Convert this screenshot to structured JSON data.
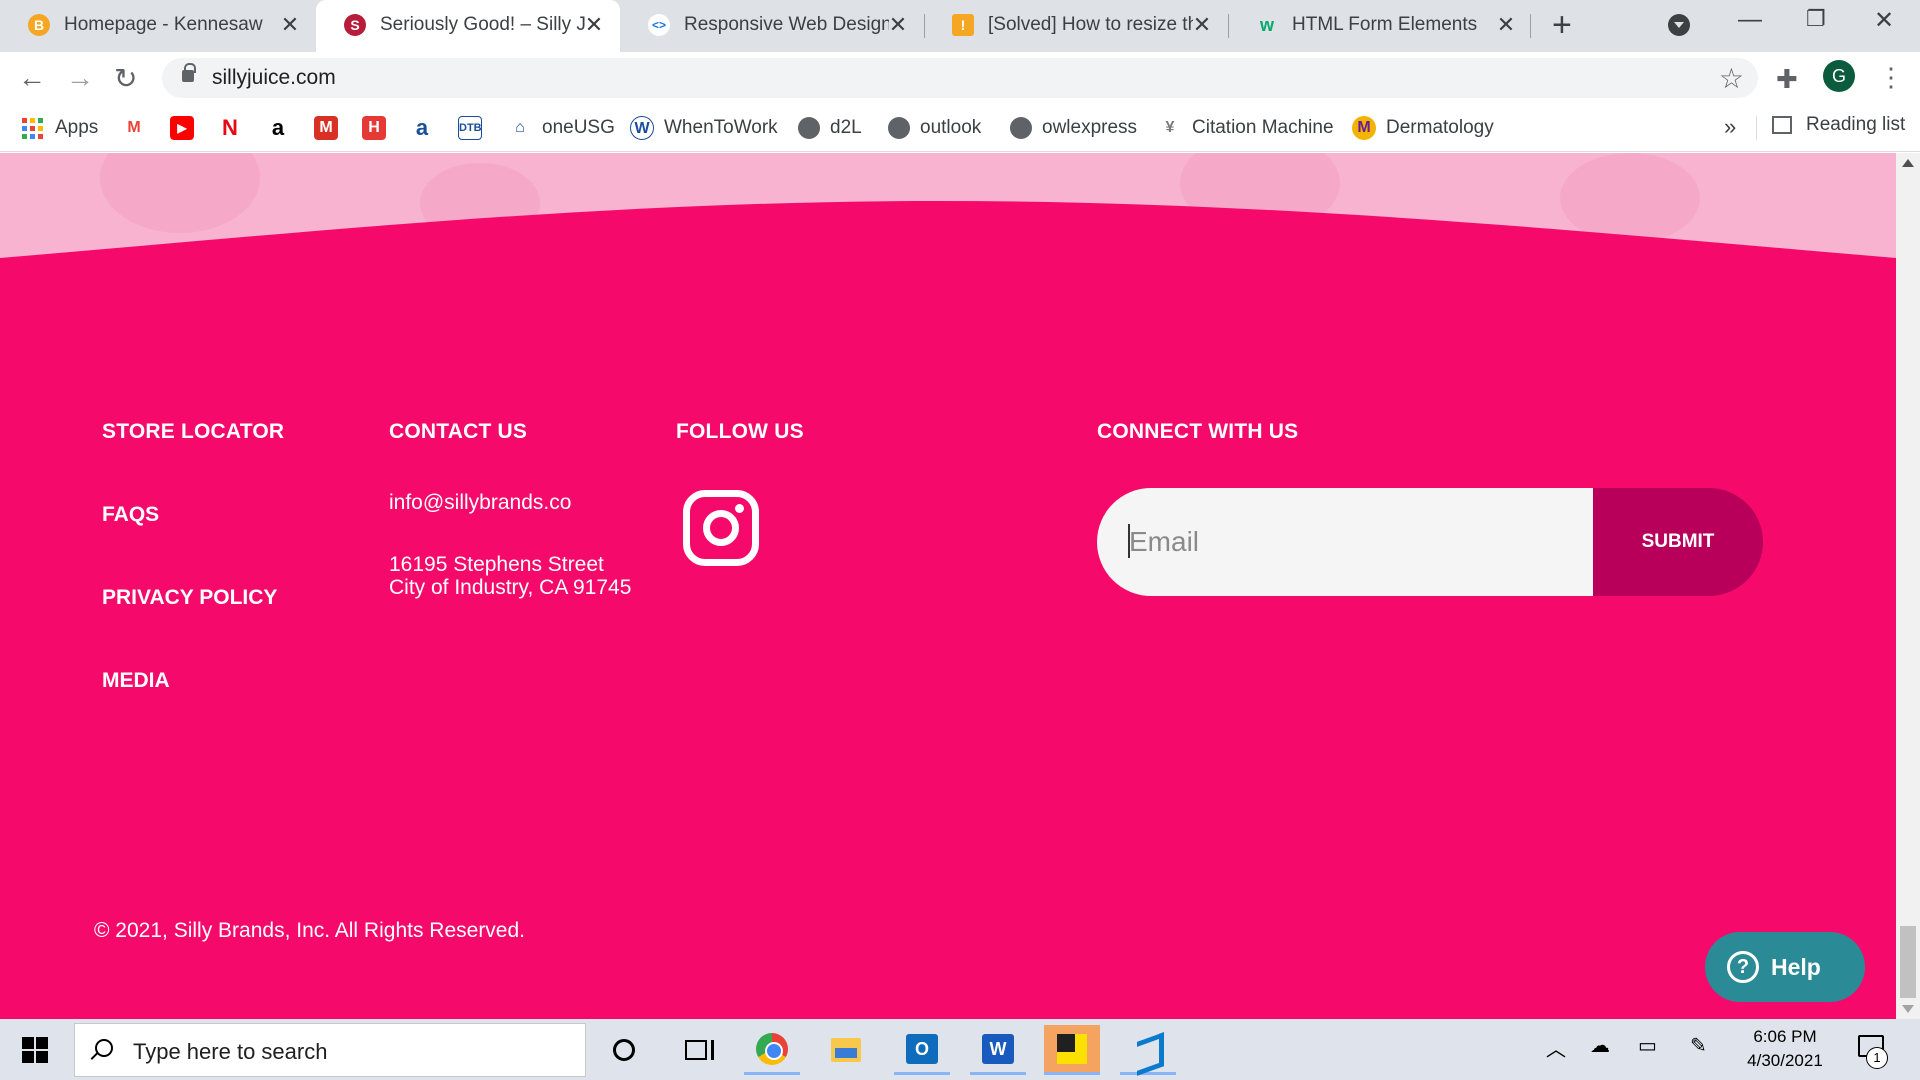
{
  "browser": {
    "tabs": [
      {
        "title": "Homepage - Kennesaw State",
        "favicon": "kennesaw-icon"
      },
      {
        "title": "Seriously Good! – Silly Juice",
        "favicon": "silly-juice-icon"
      },
      {
        "title": "Responsive Web Design Patterns",
        "favicon": "web-dev-icon"
      },
      {
        "title": "[Solved] How to resize the",
        "favicon": "solved-icon"
      },
      {
        "title": "HTML Form Elements",
        "favicon": "w3schools-icon"
      }
    ],
    "active_tab_index": 1,
    "url": "sillyjuice.com",
    "profile_initial": "G"
  },
  "bookmarks": {
    "items": [
      {
        "label": "Apps",
        "icon": "apps-grid-icon"
      },
      {
        "label": "",
        "icon": "gmail-icon"
      },
      {
        "label": "",
        "icon": "youtube-icon"
      },
      {
        "label": "",
        "icon": "netflix-icon"
      },
      {
        "label": "",
        "icon": "amazon-icon"
      },
      {
        "label": "",
        "icon": "mathway-icon"
      },
      {
        "label": "",
        "icon": "hotspot-icon"
      },
      {
        "label": "",
        "icon": "archive-icon"
      },
      {
        "label": "",
        "icon": "dtb-icon"
      },
      {
        "label": "oneUSG",
        "icon": "bank-icon"
      },
      {
        "label": "WhenToWork",
        "icon": "whentowork-icon"
      },
      {
        "label": "d2L",
        "icon": "globe-icon"
      },
      {
        "label": "outlook",
        "icon": "globe-icon"
      },
      {
        "label": "owlexpress",
        "icon": "globe-icon"
      },
      {
        "label": "Citation Machine",
        "icon": "citation-icon"
      },
      {
        "label": "Dermatology",
        "icon": "dermatology-icon"
      }
    ],
    "more": "»",
    "reading_list": "Reading list"
  },
  "footer": {
    "col1": {
      "heading": "STORE LOCATOR",
      "links": [
        "FAQS",
        "PRIVACY POLICY",
        "MEDIA"
      ]
    },
    "col2": {
      "heading": "CONTACT US",
      "email": "info@sillybrands.co",
      "address_line1": "16195 Stephens Street",
      "address_line2": "City of Industry, CA 91745"
    },
    "col3": {
      "heading": "FOLLOW US",
      "icon": "instagram-icon"
    },
    "col4": {
      "heading": "CONNECT WITH US",
      "email_placeholder": "Email",
      "submit_label": "SUBMIT"
    },
    "copyright": "© 2021, Silly Brands, Inc. All Rights Reserved.",
    "help_label": "Help"
  },
  "colors": {
    "brand_pink": "#f50a6b",
    "submit_dark_pink": "#b8005a",
    "help_teal": "#2a8b96"
  },
  "taskbar": {
    "search_placeholder": "Type here to search",
    "time": "6:06 PM",
    "date": "4/30/2021",
    "notification_count": "1"
  }
}
